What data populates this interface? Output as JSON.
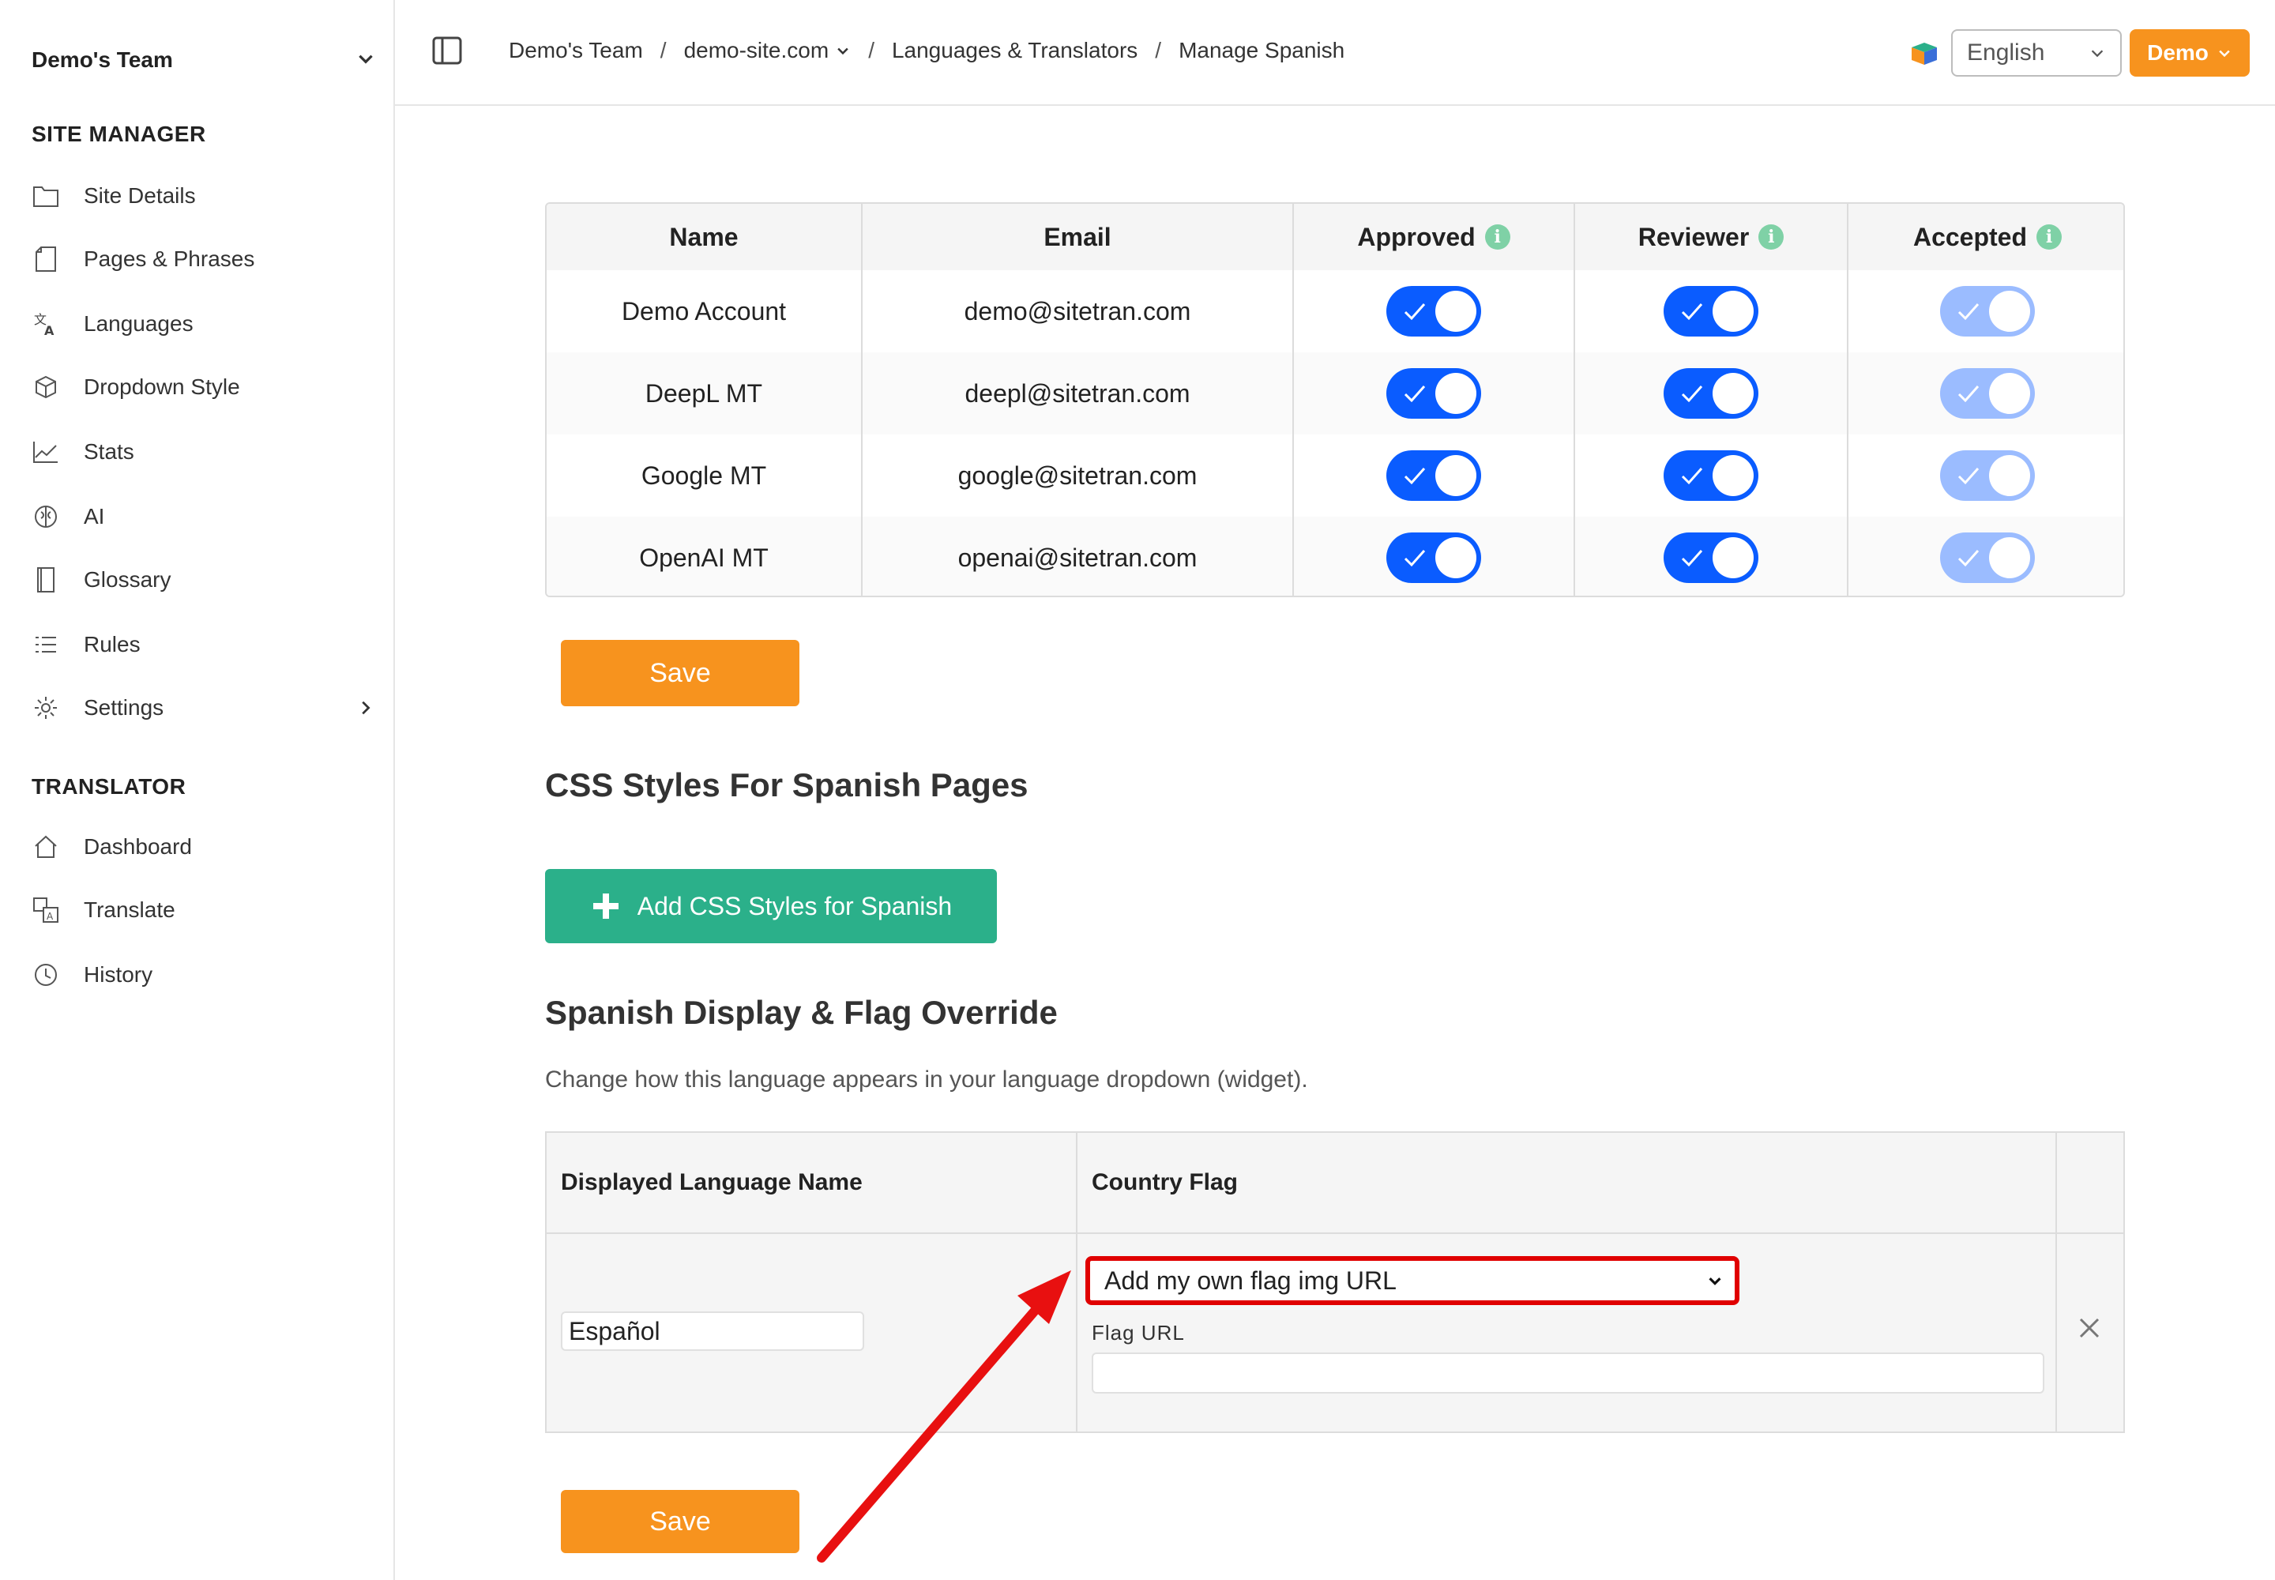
{
  "sidebar": {
    "team_name": "Demo's Team",
    "sections": [
      {
        "title": "SITE MANAGER"
      },
      {
        "title": "TRANSLATOR"
      }
    ],
    "items": [
      {
        "label": "Site Details",
        "icon": "folder-icon"
      },
      {
        "label": "Pages & Phrases",
        "icon": "page-icon"
      },
      {
        "label": "Languages",
        "icon": "translate-icon"
      },
      {
        "label": "Dropdown Style",
        "icon": "box-icon"
      },
      {
        "label": "Stats",
        "icon": "chart-icon"
      },
      {
        "label": "AI",
        "icon": "brain-icon"
      },
      {
        "label": "Glossary",
        "icon": "book-icon"
      },
      {
        "label": "Rules",
        "icon": "list-icon"
      },
      {
        "label": "Settings",
        "icon": "gear-icon"
      },
      {
        "label": "Dashboard",
        "icon": "home-icon"
      },
      {
        "label": "Translate",
        "icon": "translate-doc-icon"
      },
      {
        "label": "History",
        "icon": "clock-icon"
      }
    ]
  },
  "topbar": {
    "breadcrumb": [
      "Demo's Team",
      "demo-site.com",
      "Languages & Translators",
      "Manage Spanish"
    ],
    "language_selected": "English",
    "account_label": "Demo"
  },
  "translators_table": {
    "headers": [
      "Name",
      "Email",
      "Approved",
      "Reviewer",
      "Accepted"
    ],
    "rows": [
      {
        "name": "Demo Account",
        "email": "demo@sitetran.com",
        "approved": true,
        "reviewer": true,
        "accepted": true
      },
      {
        "name": "DeepL MT",
        "email": "deepl@sitetran.com",
        "approved": true,
        "reviewer": true,
        "accepted": true
      },
      {
        "name": "Google MT",
        "email": "google@sitetran.com",
        "approved": true,
        "reviewer": true,
        "accepted": true
      },
      {
        "name": "OpenAI MT",
        "email": "openai@sitetran.com",
        "approved": true,
        "reviewer": true,
        "accepted": true
      }
    ],
    "save_label": "Save"
  },
  "css_section": {
    "title": "CSS Styles For Spanish Pages",
    "add_button": "Add CSS Styles for Spanish"
  },
  "display_section": {
    "title": "Spanish Display & Flag Override",
    "description": "Change how this language appears in your language dropdown (widget).",
    "headers": [
      "Displayed Language Name",
      "Country Flag"
    ],
    "language_name_value": "Español",
    "flag_select_value": "Add my own flag img URL",
    "flag_url_label": "Flag URL",
    "flag_url_value": "",
    "save_label": "Save"
  },
  "colors": {
    "accent_orange": "#f7931e",
    "toggle_blue": "#0a5cff",
    "toggle_blue_light": "#9bbcff",
    "add_button_green": "#2bb08a",
    "highlight_red": "#e00000"
  }
}
